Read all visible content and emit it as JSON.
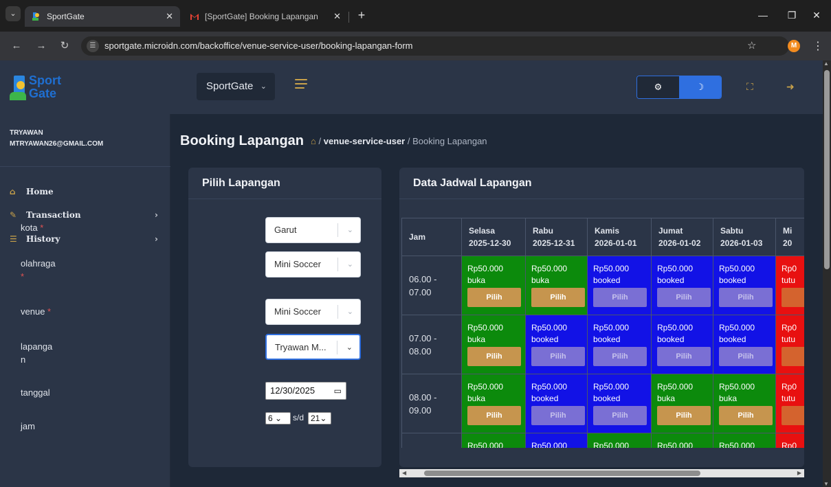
{
  "browser": {
    "tabs": [
      {
        "title": "SportGate",
        "active": true
      },
      {
        "title": "[SportGate] Booking Lapangan",
        "active": false
      }
    ],
    "url": "sportgate.microidn.com/backoffice/venue-service-user/booking-lapangan-form",
    "profile_initial": "M"
  },
  "header": {
    "logo_line1": "Sport",
    "logo_line2": "Gate",
    "workspace": "SportGate"
  },
  "user": {
    "name": "TRYAWAN",
    "email": "MTRYAWAN26@GMAIL.COM"
  },
  "sidebar": {
    "items": [
      {
        "label": "Home",
        "icon": "home-icon",
        "has_children": false
      },
      {
        "label": "Transaction",
        "icon": "edit-icon",
        "has_children": true
      },
      {
        "label": "History",
        "icon": "list-icon",
        "has_children": true
      }
    ]
  },
  "page": {
    "title": "Booking Lapangan",
    "breadcrumb": [
      "venue-service-user",
      "Booking Lapangan"
    ]
  },
  "form": {
    "card_title": "Pilih Lapangan",
    "kota": {
      "label": "kota",
      "required": true,
      "value": "Garut"
    },
    "olahraga": {
      "label": "olahraga",
      "required": true,
      "value": "Mini Soccer"
    },
    "venue": {
      "label": "venue",
      "required": true,
      "value": "Mini Soccer"
    },
    "lapangan": {
      "label_line1": "lapanga",
      "label_line2": "n",
      "value": "Tryawan M..."
    },
    "tanggal": {
      "label": "tanggal",
      "value": "12/30/2025"
    },
    "jam": {
      "label": "jam",
      "from": "6",
      "sd": "s/d",
      "to": "21"
    }
  },
  "schedule": {
    "card_title": "Data Jadwal Lapangan",
    "jam_header": "Jam",
    "columns": [
      {
        "day": "Selasa",
        "date": "2025-12-30"
      },
      {
        "day": "Rabu",
        "date": "2025-12-31"
      },
      {
        "day": "Kamis",
        "date": "2026-01-01"
      },
      {
        "day": "Jumat",
        "date": "2026-01-02"
      },
      {
        "day": "Sabtu",
        "date": "2026-01-03"
      },
      {
        "day": "Mi",
        "date": "20"
      }
    ],
    "button_label": "Pilih",
    "rows": [
      {
        "time1": "06.00 -",
        "time2": "07.00",
        "cells": [
          {
            "price": "Rp50.000",
            "status": "buka"
          },
          {
            "price": "Rp50.000",
            "status": "buka"
          },
          {
            "price": "Rp50.000",
            "status": "booked"
          },
          {
            "price": "Rp50.000",
            "status": "booked"
          },
          {
            "price": "Rp50.000",
            "status": "booked"
          },
          {
            "price": "Rp0",
            "status": "tutu"
          }
        ]
      },
      {
        "time1": "07.00 -",
        "time2": "08.00",
        "cells": [
          {
            "price": "Rp50.000",
            "status": "buka"
          },
          {
            "price": "Rp50.000",
            "status": "booked"
          },
          {
            "price": "Rp50.000",
            "status": "booked"
          },
          {
            "price": "Rp50.000",
            "status": "booked"
          },
          {
            "price": "Rp50.000",
            "status": "booked"
          },
          {
            "price": "Rp0",
            "status": "tutu"
          }
        ]
      },
      {
        "time1": "08.00 -",
        "time2": "09.00",
        "cells": [
          {
            "price": "Rp50.000",
            "status": "buka"
          },
          {
            "price": "Rp50.000",
            "status": "booked"
          },
          {
            "price": "Rp50.000",
            "status": "booked"
          },
          {
            "price": "Rp50.000",
            "status": "buka"
          },
          {
            "price": "Rp50.000",
            "status": "buka"
          },
          {
            "price": "Rp0",
            "status": "tutu"
          }
        ]
      }
    ],
    "partial_row": {
      "cells": [
        {
          "price": "Rp50.000",
          "kind": "buka"
        },
        {
          "price": "Rp50.000",
          "kind": "booked"
        },
        {
          "price": "Rp50.000",
          "kind": "buka"
        },
        {
          "price": "Rp50.000",
          "kind": "buka"
        },
        {
          "price": "Rp50.000",
          "kind": "buka"
        },
        {
          "price": "Rp0",
          "kind": "tutup"
        }
      ]
    },
    "status_colors": {
      "buka": "#0c8a0c",
      "booked": "#1212e6",
      "tutup": "#e81010"
    }
  }
}
